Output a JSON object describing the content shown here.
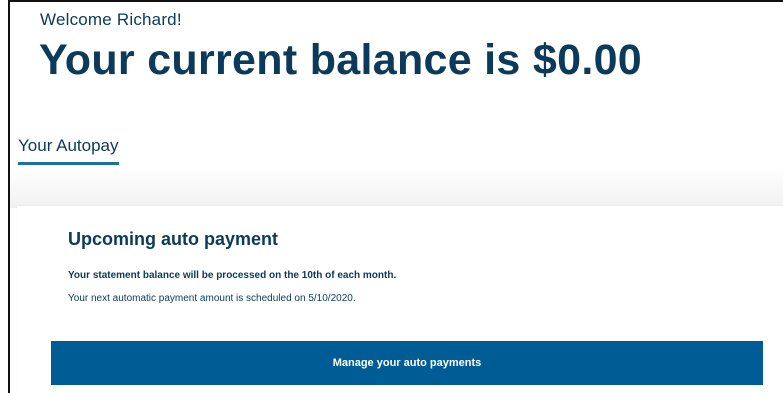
{
  "header": {
    "welcome": "Welcome Richard!",
    "balance": "Your current balance is $0.00"
  },
  "tabs": {
    "autopay_label": "Your Autopay"
  },
  "card": {
    "title": "Upcoming auto payment",
    "statement_line": "Your statement balance will be processed on the 10th of each month.",
    "next_payment_line": "Your next automatic payment amount is scheduled on 5/10/2020.",
    "manage_button_label": "Manage your auto payments"
  },
  "colors": {
    "primary_text": "#0b3a5a",
    "button_bg": "#005c94",
    "tab_underline": "#1f6f9f"
  }
}
